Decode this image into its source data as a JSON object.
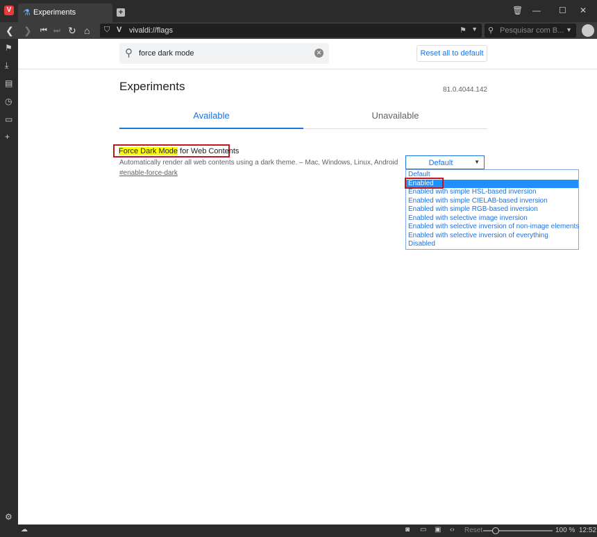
{
  "browser": {
    "tab_title": "Experiments",
    "address": "vivaldi://flags",
    "search_placeholder": "Pesquisar com B...",
    "zoom": "100 %",
    "reset_label": "Reset",
    "clock": "12:52"
  },
  "page": {
    "search_query": "force dark mode",
    "reset_all": "Reset all to default",
    "title": "Experiments",
    "version": "81.0.4044.142",
    "tabs": [
      "Available",
      "Unavailable"
    ],
    "experiment": {
      "title_highlight": "Force Dark Mode",
      "title_rest": " for Web Contents",
      "description": "Automatically render all web contents using a dark theme. – Mac, Windows, Linux, Android",
      "link": "#enable-force-dark",
      "selected": "Default",
      "options": [
        "Default",
        "Enabled",
        "Enabled with simple HSL-based inversion",
        "Enabled with simple CIELAB-based inversion",
        "Enabled with simple RGB-based inversion",
        "Enabled with selective image inversion",
        "Enabled with selective inversion of non-image elements",
        "Enabled with selective inversion of everything",
        "Disabled"
      ],
      "highlighted_option_index": 1
    }
  },
  "colors": {
    "accent": "#1a73e8",
    "annotation_red": "#c0161f",
    "highlight": "#ffff00",
    "selected_option_bg": "#1e90ff"
  }
}
